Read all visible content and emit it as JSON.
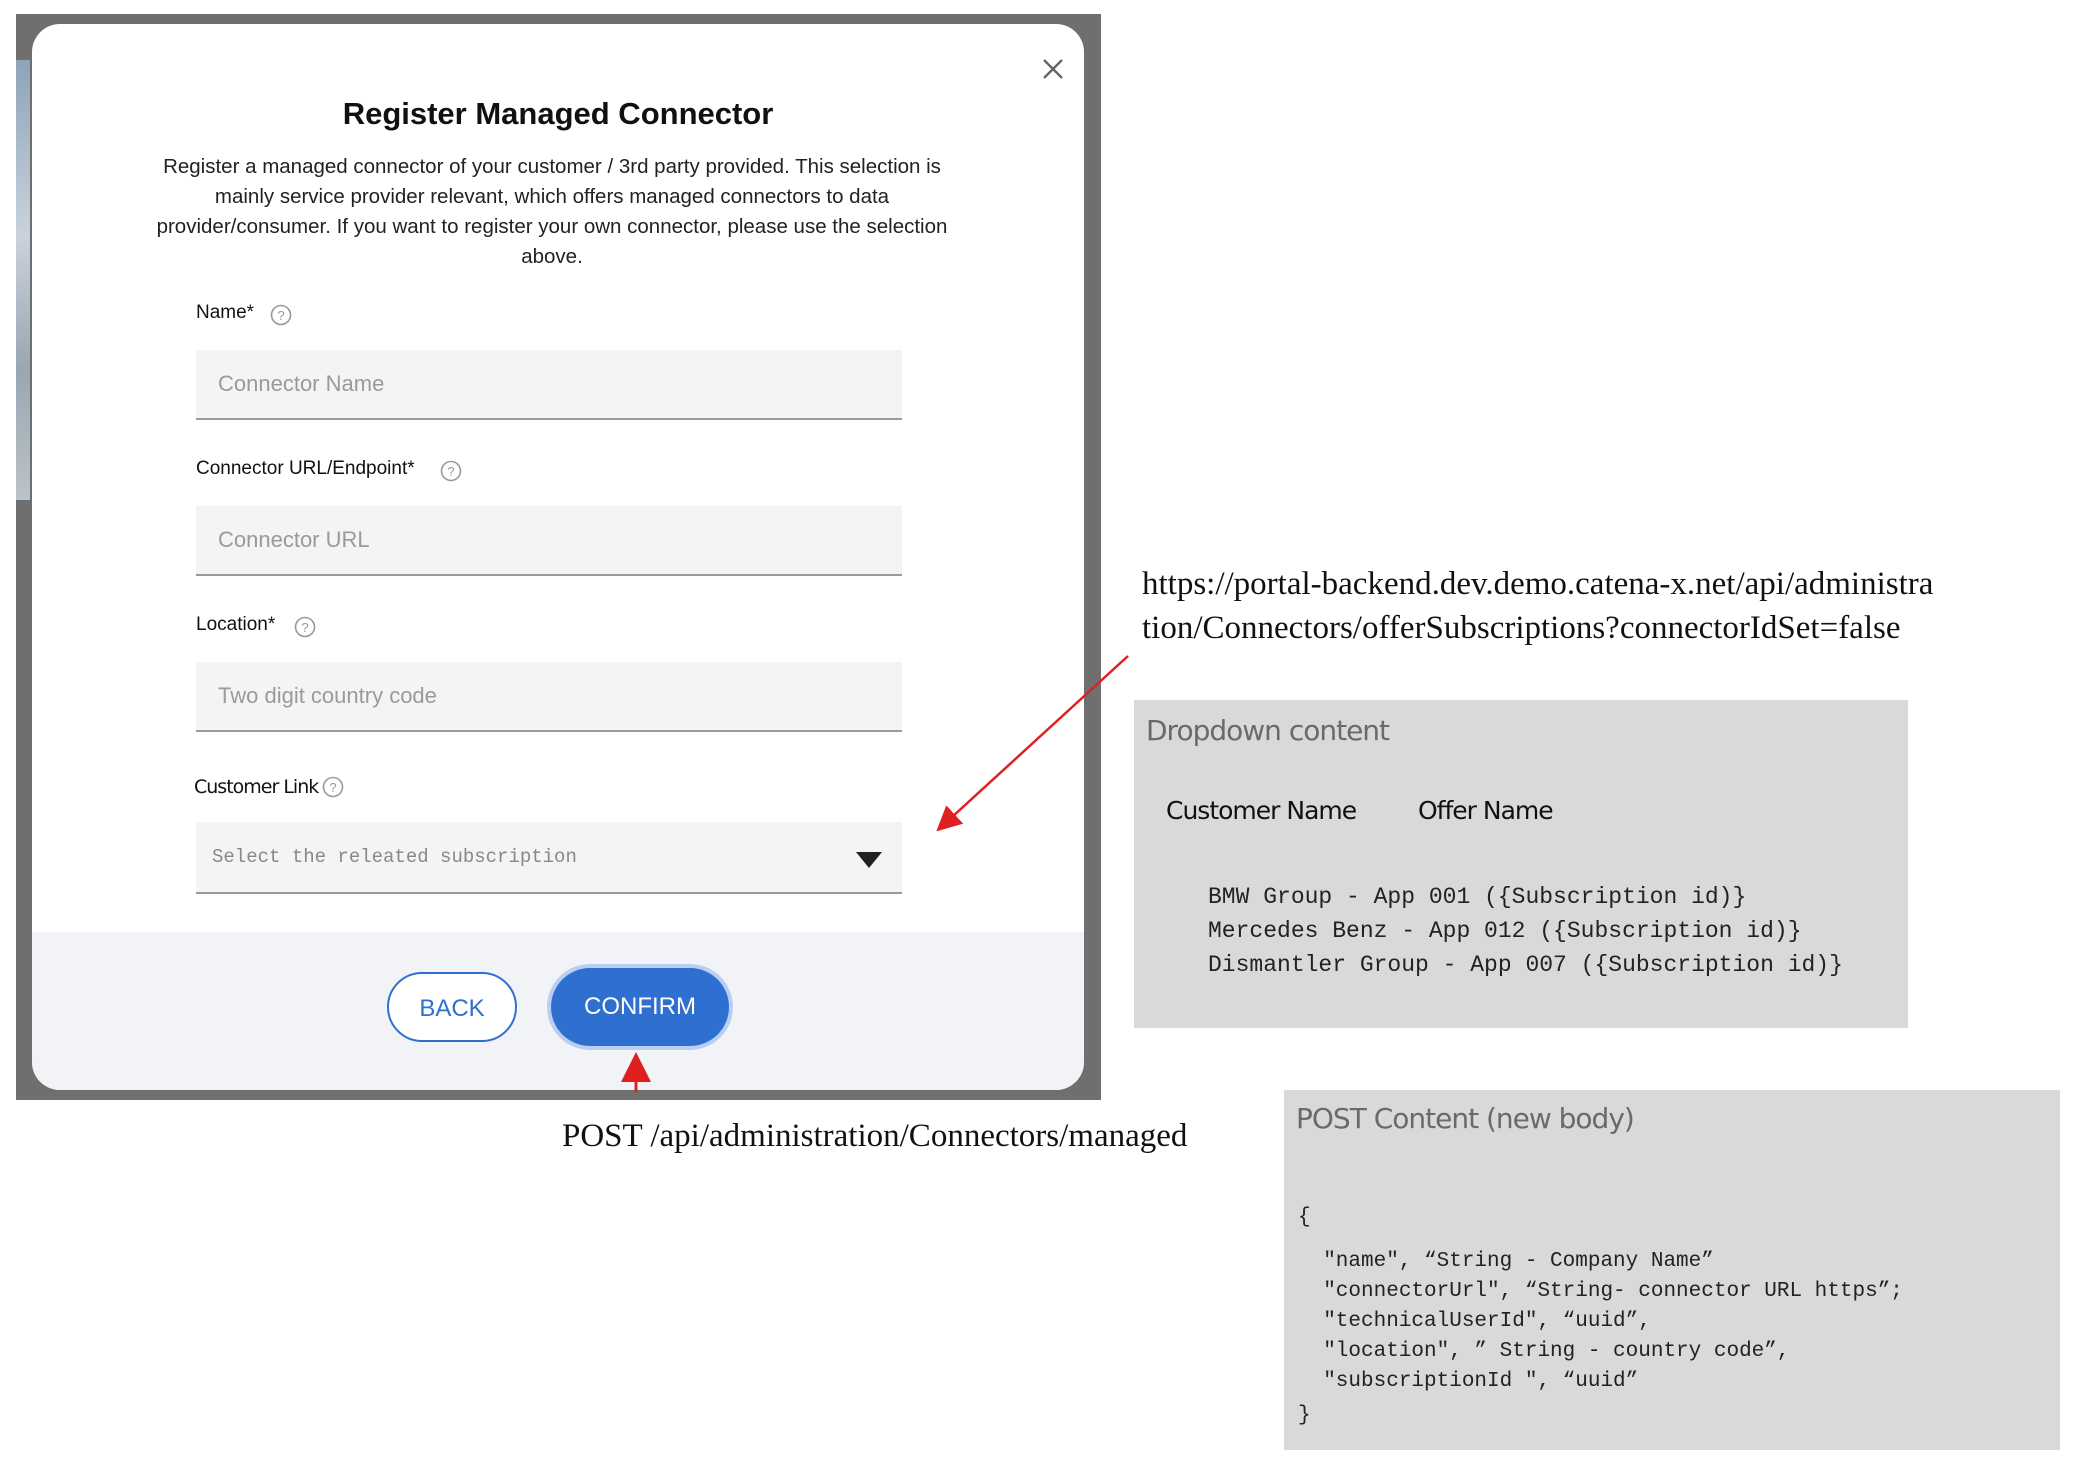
{
  "modal": {
    "title": "Register Managed Connector",
    "description": "Register a managed connector of your customer / 3rd party provided. This selection is mainly service provider relevant, which offers managed connectors to data provider/consumer. If you want to register your own connector, please use the selection above.",
    "fields": {
      "name": {
        "label": "Name*",
        "placeholder": "Connector Name"
      },
      "url": {
        "label": "Connector URL/Endpoint*",
        "placeholder": "Connector URL"
      },
      "location": {
        "label": "Location*",
        "placeholder": "Two digit country code"
      },
      "customer_link": {
        "label": "Customer Link",
        "placeholder": "Select the releated subscription"
      }
    },
    "buttons": {
      "back": "BACK",
      "confirm": "CONFIRM"
    }
  },
  "annotations": {
    "endpoint_url": "https://portal-backend.dev.demo.catena-x.net/api/administration/Connectors/offerSubscriptions?connectorIdSet=false",
    "post_endpoint": "POST /api/administration/Connectors/managed",
    "dropdown_box": {
      "title": "Dropdown content",
      "col_customer": "Customer Name",
      "col_offer": "Offer Name",
      "lines": [
        "BMW Group - App 001 ({Subscription id)}",
        "Mercedes Benz - App 012 ({Subscription id)}",
        "Dismantler Group - App 007 ({Subscription id)}"
      ]
    },
    "post_box": {
      "title": "POST Content (new body)",
      "lines": [
        "{",
        "  \"name\", “String - Company Name”",
        "  \"connectorUrl\", “String- connector URL https”;",
        "  \"technicalUserId\", “uuid”,",
        "  \"location\", ” String - country code”,",
        "  \"subscriptionId \", “uuid”",
        "}"
      ]
    }
  },
  "colors": {
    "primary": "#2f6fd0",
    "annotation_arrow": "#e02020",
    "gray_box": "#d9d9d9"
  }
}
